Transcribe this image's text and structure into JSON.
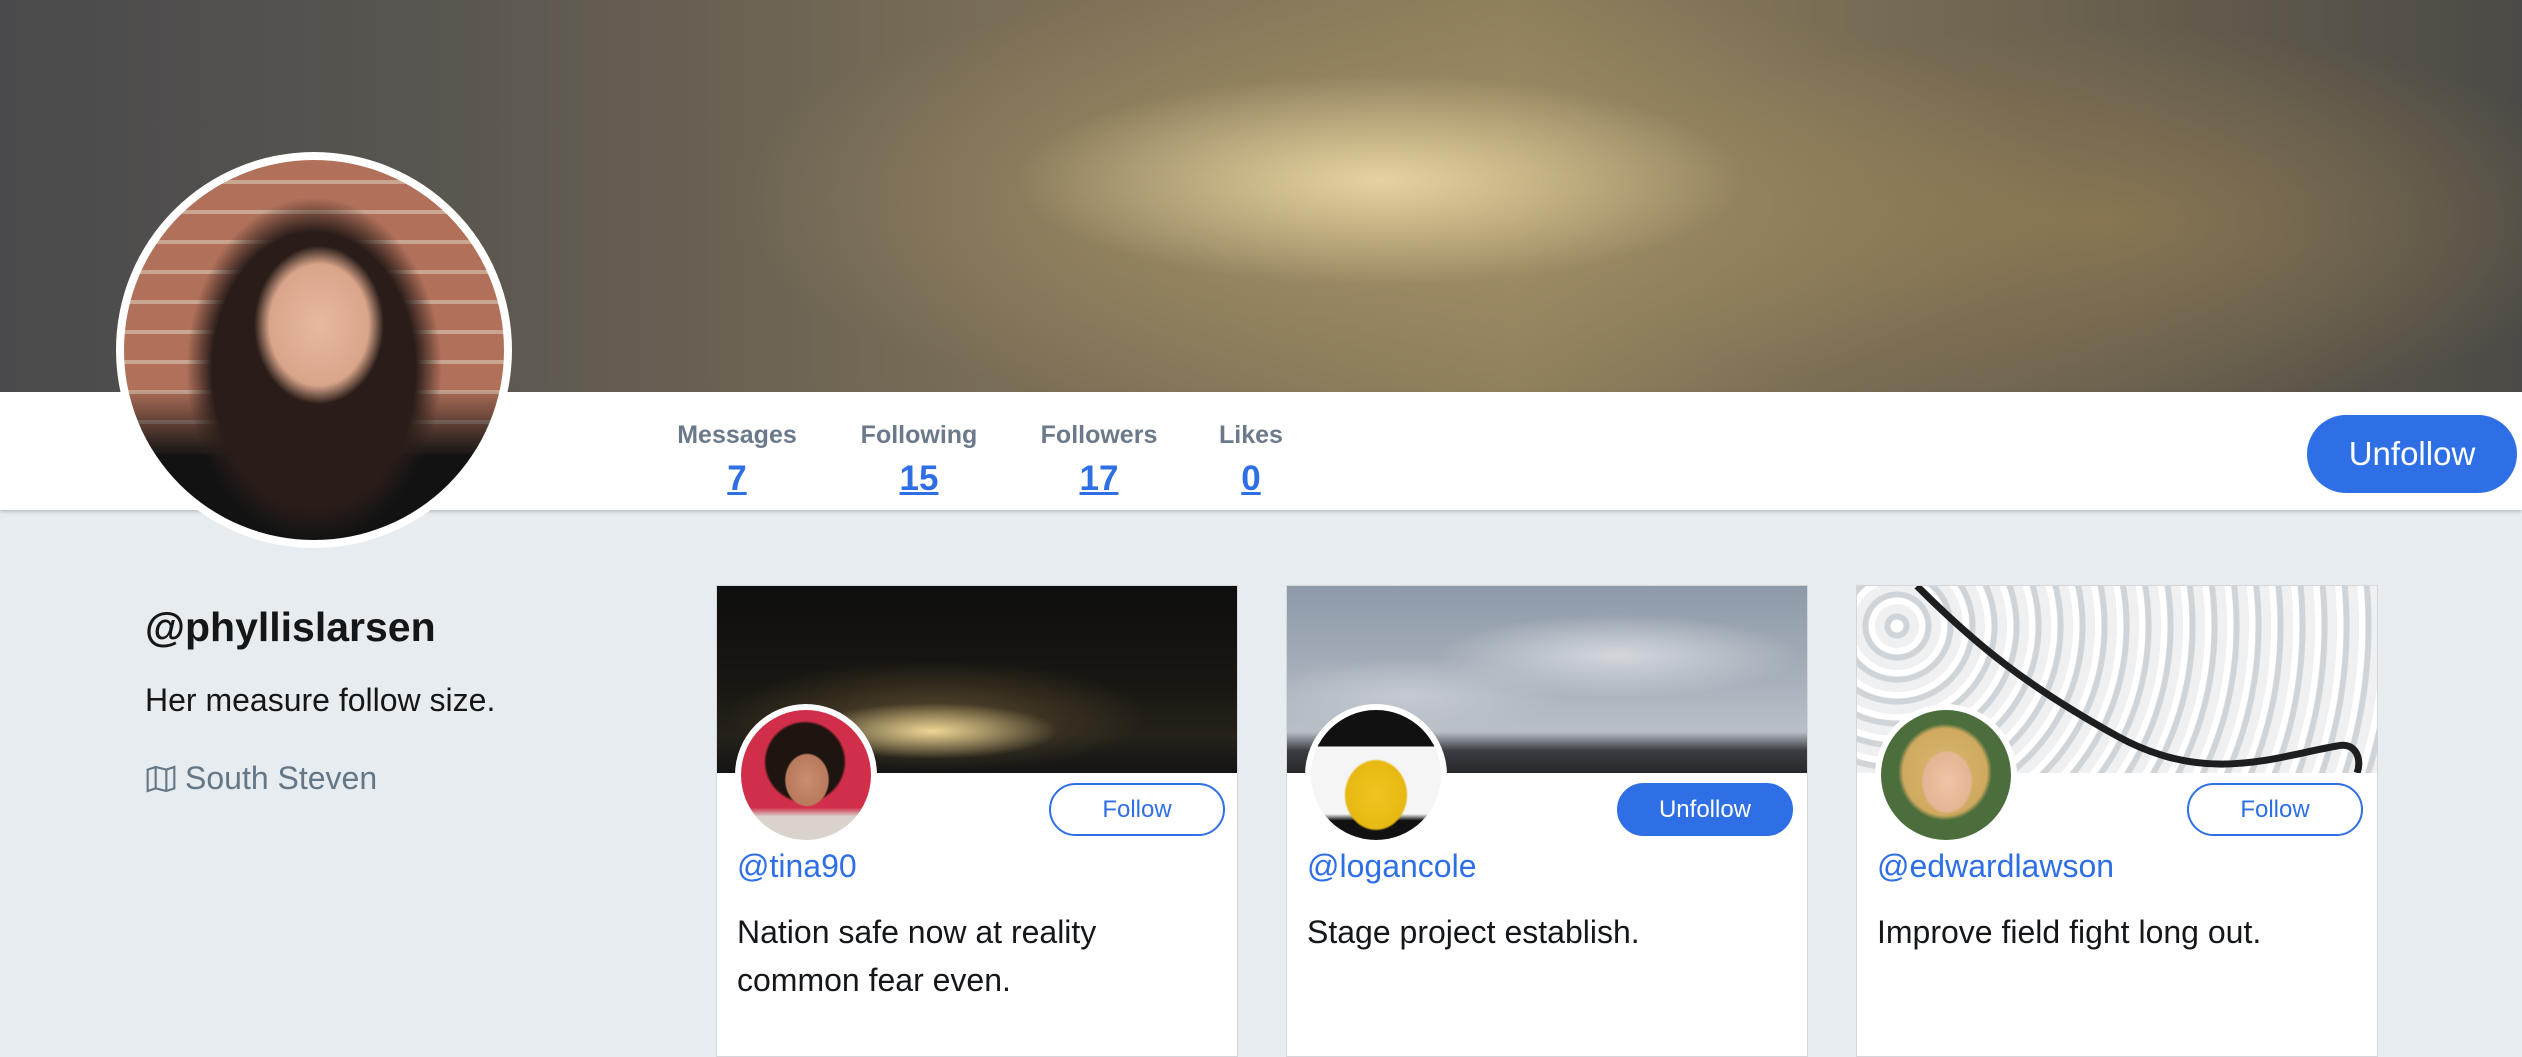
{
  "stats": [
    {
      "label": "Messages",
      "value": "7"
    },
    {
      "label": "Following",
      "value": "15"
    },
    {
      "label": "Followers",
      "value": "17"
    },
    {
      "label": "Likes",
      "value": "0"
    }
  ],
  "profile": {
    "handle": "@phyllislarsen",
    "bio": "Her measure follow size.",
    "location": "South Steven",
    "action_label": "Unfollow"
  },
  "icons": {
    "location": "map-icon"
  },
  "colors": {
    "accent": "#2f6fe6",
    "page_background": "#e6ecf0"
  },
  "cards": [
    {
      "handle": "@tina90",
      "text": "Nation safe now at reality common fear even.",
      "button": "Follow"
    },
    {
      "handle": "@logancole",
      "text": "Stage project establish.",
      "button": "Unfollow"
    },
    {
      "handle": "@edwardlawson",
      "text": "Improve field fight long out.",
      "button": "Follow"
    }
  ]
}
